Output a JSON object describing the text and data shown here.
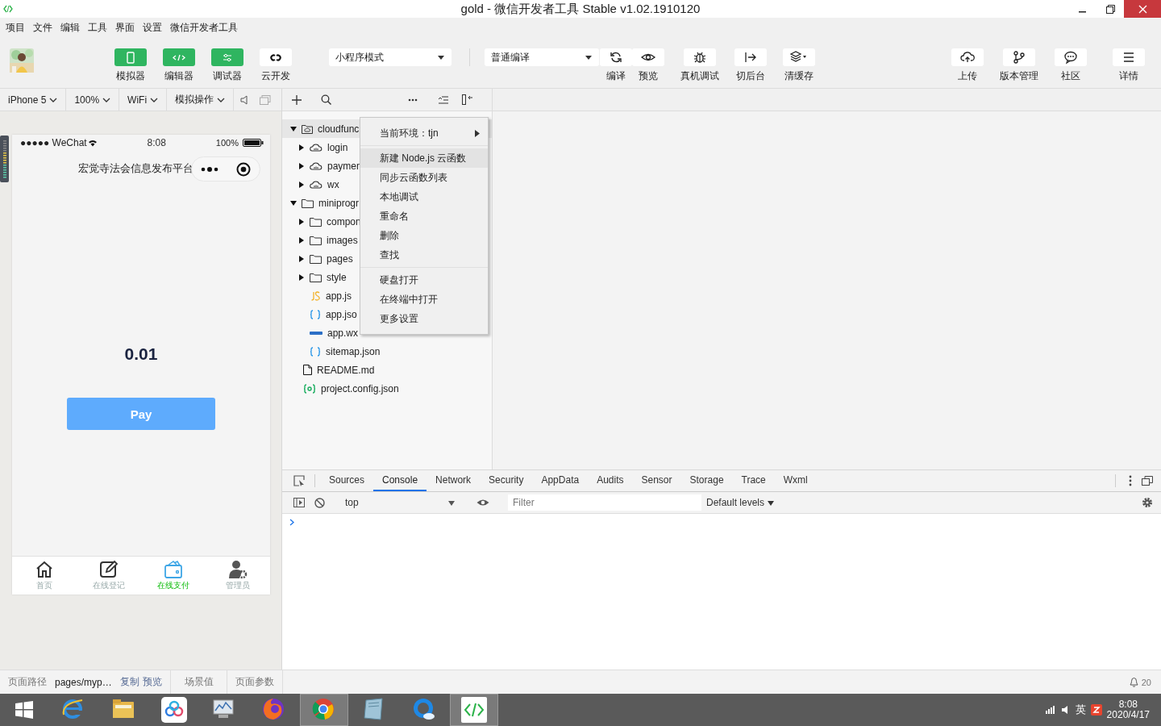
{
  "window": {
    "title": "gold - 微信开发者工具 Stable v1.02.1910120"
  },
  "menu_bar": [
    "项目",
    "文件",
    "编辑",
    "工具",
    "界面",
    "设置",
    "微信开发者工具"
  ],
  "toolbar": {
    "view_buttons": [
      {
        "label": "模拟器",
        "active": true
      },
      {
        "label": "编辑器",
        "active": true
      },
      {
        "label": "调试器",
        "active": true
      },
      {
        "label": "云开发",
        "active": false
      }
    ],
    "mode_select": {
      "value": "小程序模式"
    },
    "compile_select": {
      "value": "普通编译"
    },
    "actions": [
      {
        "label": "编译"
      },
      {
        "label": "预览"
      },
      {
        "label": "真机调试"
      },
      {
        "label": "切后台"
      },
      {
        "label": "清缓存"
      }
    ],
    "right_buttons": [
      {
        "label": "上传"
      },
      {
        "label": "版本管理"
      },
      {
        "label": "社区"
      },
      {
        "label": "详情"
      }
    ]
  },
  "simulator_bar": [
    "iPhone 5",
    "100%",
    "WiFi",
    "模拟操作"
  ],
  "phone": {
    "carrier": "●●●●● WeChat",
    "time": "8:08",
    "battery": "100%",
    "nav_title": "宏觉寺法会信息发布平台",
    "amount": "0.01",
    "pay_button": "Pay",
    "tab_bar": [
      {
        "label": "首页",
        "selected": false
      },
      {
        "label": "在线登记",
        "selected": false
      },
      {
        "label": "在线支付",
        "selected": true
      },
      {
        "label": "管理员",
        "selected": false
      }
    ]
  },
  "file_tree": [
    {
      "name": "cloudfunc",
      "kind": "cloud-root",
      "expanded": true,
      "selected": true,
      "children": [
        {
          "name": "login",
          "kind": "cloud",
          "expanded": false,
          "selected": false
        },
        {
          "name": "paymen",
          "kind": "cloud",
          "expanded": false,
          "selected": false
        },
        {
          "name": "wx",
          "kind": "cloud",
          "expanded": false,
          "selected": false
        }
      ]
    },
    {
      "name": "miniprogr",
      "kind": "folder",
      "expanded": true,
      "selected": false,
      "children": [
        {
          "name": "compon",
          "kind": "folder",
          "expanded": false,
          "selected": false
        },
        {
          "name": "images",
          "kind": "folder",
          "expanded": false,
          "selected": false
        },
        {
          "name": "pages",
          "kind": "folder",
          "expanded": false,
          "selected": false
        },
        {
          "name": "style",
          "kind": "folder",
          "expanded": false,
          "selected": false
        },
        {
          "name": "app.js",
          "kind": "js",
          "selected": false
        },
        {
          "name": "app.jso",
          "kind": "json",
          "selected": false
        },
        {
          "name": "app.wx",
          "kind": "wxss",
          "selected": false
        },
        {
          "name": "sitemap.json",
          "kind": "json",
          "selected": false
        }
      ]
    },
    {
      "name": "README.md",
      "kind": "file",
      "selected": false
    },
    {
      "name": "project.config.json",
      "kind": "config",
      "selected": false
    }
  ],
  "context_menu": [
    [
      {
        "label": "当前环境：tjn",
        "submenu": true,
        "selected": false
      }
    ],
    [
      {
        "label": "新建 Node.js 云函数",
        "submenu": false,
        "selected": true
      },
      {
        "label": "同步云函数列表",
        "submenu": false,
        "selected": false
      },
      {
        "label": "本地调试",
        "submenu": false,
        "selected": false
      },
      {
        "label": "重命名",
        "submenu": false,
        "selected": false
      },
      {
        "label": "删除",
        "submenu": false,
        "selected": false
      },
      {
        "label": "查找",
        "submenu": false,
        "selected": false
      }
    ],
    [
      {
        "label": "硬盘打开",
        "submenu": false,
        "selected": false
      },
      {
        "label": "在终端中打开",
        "submenu": false,
        "selected": false
      },
      {
        "label": "更多设置",
        "submenu": false,
        "selected": false
      }
    ]
  ],
  "devtools": {
    "tabs": [
      {
        "label": "Sources",
        "selected": false
      },
      {
        "label": "Console",
        "selected": true
      },
      {
        "label": "Network",
        "selected": false
      },
      {
        "label": "Security",
        "selected": false
      },
      {
        "label": "AppData",
        "selected": false
      },
      {
        "label": "Audits",
        "selected": false
      },
      {
        "label": "Sensor",
        "selected": false
      },
      {
        "label": "Storage",
        "selected": false
      },
      {
        "label": "Trace",
        "selected": false
      },
      {
        "label": "Wxml",
        "selected": false
      }
    ],
    "context": "top",
    "filter": {
      "placeholder": "Filter"
    },
    "levels": "Default levels"
  },
  "status_bar": {
    "path_label": "页面路径",
    "path": "pages/myp…",
    "copy": "复制",
    "preview": "预览",
    "scene": "场景值",
    "params": "页面参数",
    "notifications": "20"
  },
  "taskbar": {
    "apps": [
      {
        "kind": "start",
        "selected": false
      },
      {
        "kind": "e-browser",
        "selected": false
      },
      {
        "kind": "folder",
        "selected": false
      },
      {
        "kind": "cloud-app",
        "selected": false
      },
      {
        "kind": "monitor",
        "selected": false
      },
      {
        "kind": "fox-browser",
        "selected": false
      },
      {
        "kind": "round-browser",
        "selected": true
      },
      {
        "kind": "notepad",
        "selected": false
      },
      {
        "kind": "q-browser",
        "selected": false
      },
      {
        "kind": "code-tool",
        "selected": true
      }
    ],
    "ime": "英",
    "time": "8:08",
    "date": "2020/4/17"
  }
}
